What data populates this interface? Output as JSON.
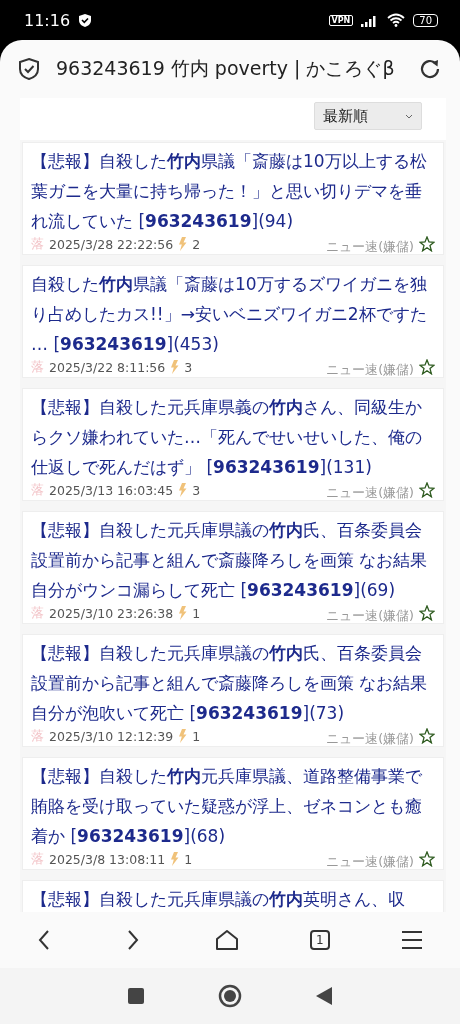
{
  "status_bar": {
    "time": "11:16",
    "vpn": "VPN",
    "battery": "70"
  },
  "address_bar": {
    "title": "963243619 竹内 poverty | かころぐβ"
  },
  "sort": {
    "value": "最新順"
  },
  "threads": [
    {
      "title": "【悲報】自殺した**竹内**県議「斎藤は10万以上する松葉ガニを大量に持ち帰った！」と思い切りデマを垂れ流していた [**963243619**](94)",
      "mark": "落",
      "date": "2025/3/28 22:22:56",
      "count": "2",
      "board": "ニュー速(嫌儲)"
    },
    {
      "title": "自殺した**竹内**県議「斎藤は10万するズワイガニを独り占めしたカス!!」→安いベニズワイガニ2杯ですた… [**963243619**](453)",
      "mark": "落",
      "date": "2025/3/22 8:11:56",
      "count": "3",
      "board": "ニュー速(嫌儲)"
    },
    {
      "title": "【悲報】自殺した元兵庫県義の**竹内**さん、同級生からクソ嫌われていた…「死んでせいせいした、俺の仕返しで死んだはず」 [**963243619**](131)",
      "mark": "落",
      "date": "2025/3/13 16:03:45",
      "count": "3",
      "board": "ニュー速(嫌儲)"
    },
    {
      "title": "【悲報】自殺した元兵庫県議の**竹内**氏、百条委員会設置前から記事と組んで斎藤降ろしを画策 なお結果自分がウンコ漏らして死亡 [**963243619**](69)",
      "mark": "落",
      "date": "2025/3/10 23:26:38",
      "count": "1",
      "board": "ニュー速(嫌儲)"
    },
    {
      "title": "【悲報】自殺した元兵庫県議の**竹内**氏、百条委員会設置前から記事と組んで斎藤降ろしを画策 なお結果自分が泡吹いて死亡 [**963243619**](73)",
      "mark": "落",
      "date": "2025/3/10 12:12:39",
      "count": "1",
      "board": "ニュー速(嫌儲)"
    },
    {
      "title": "【悲報】自殺した**竹内**元兵庫県議、道路整備事業で賄賂を受け取っていた疑惑が浮上、ゼネコンとも癒着か [**963243619**](68)",
      "mark": "落",
      "date": "2025/3/8 13:08:11",
      "count": "1",
      "board": "ニュー速(嫌儲)"
    },
    {
      "title": "【悲報】自殺した元兵庫県議の**竹内**英明さん、収"
    }
  ],
  "bottom_nav": {
    "tab_count": "1"
  }
}
